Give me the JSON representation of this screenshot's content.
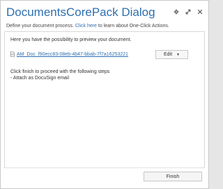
{
  "dialog": {
    "title": "DocumentsCorePack Dialog",
    "subtitle_prefix": "Define your document process. ",
    "subtitle_link": "Click here",
    "subtitle_suffix": " to learn about One-Click Actions.",
    "window_controls": [
      "gear-icon",
      "maximize-icon",
      "close-icon"
    ]
  },
  "main": {
    "preview_text": "Here you have the possibility to preview your document.",
    "document_name": "AM_Doc_f90ecc83-08eb-4b47-bbab-7f7a16253221",
    "document_icon": "document-icon",
    "edit_label": "Edit",
    "steps_line1": "Click finish to proceed with the following steps",
    "steps_line2": "- Attach as DocuSign email"
  },
  "footer": {
    "finish_label": "Finish"
  },
  "colors": {
    "accent": "#2d6fb0",
    "text": "#333333",
    "border": "#c6c6c6"
  }
}
